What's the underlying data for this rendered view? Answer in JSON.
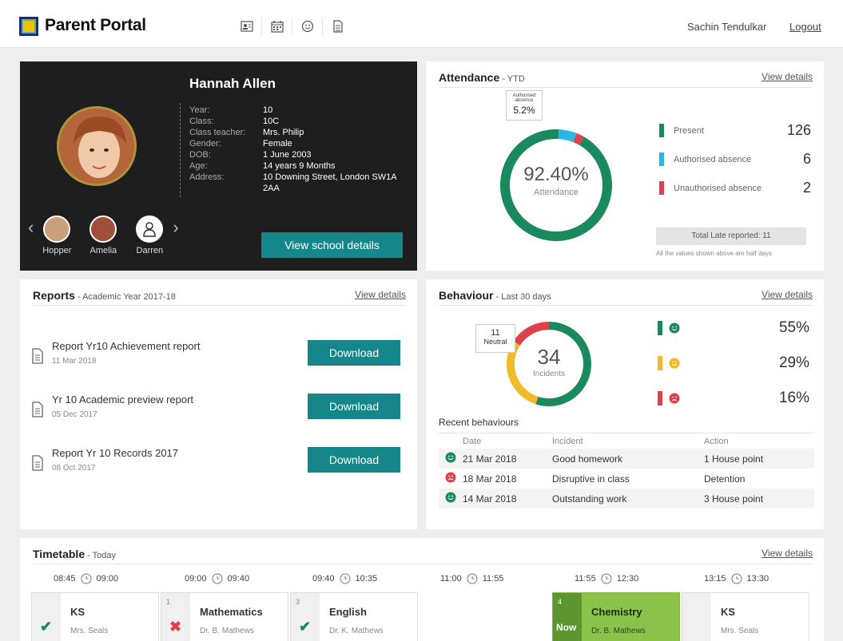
{
  "app": {
    "brand": "Parent Portal",
    "user": "Sachin Tendulkar",
    "logout": "Logout",
    "nav_icons": [
      "id-card-icon",
      "calendar-icon",
      "smiley-icon",
      "document-icon"
    ]
  },
  "student": {
    "name": "Hannah Allen",
    "fields": [
      {
        "label": "Year:",
        "value": "10"
      },
      {
        "label": "Class:",
        "value": "10C"
      },
      {
        "label": "Class teacher:",
        "value": "Mrs. Philip"
      },
      {
        "label": "Gender:",
        "value": "Female"
      },
      {
        "label": "DOB:",
        "value": "1 June 2003"
      },
      {
        "label": "Age:",
        "value": "14 years 9 Months"
      },
      {
        "label": "Address:",
        "value": "10 Downing Street, London SW1A 2AA"
      }
    ],
    "siblings": [
      "Hopper",
      "Amelia",
      "Darren"
    ],
    "view_button": "View school details"
  },
  "attendance": {
    "title": "Attendance",
    "subtitle": " - YTD",
    "view": "View details",
    "center_value": "92.40%",
    "center_label": "Attendance",
    "callout_label": "Authorised absence",
    "callout_value": "5.2%",
    "fractions": {
      "present": 0.924,
      "authorised": 0.052,
      "unauthorised": 0.024
    },
    "legend": [
      {
        "label": "Present",
        "value": "126",
        "color": "#1a8a5e"
      },
      {
        "label": "Authorised absence",
        "value": "6",
        "color": "#29b6e8"
      },
      {
        "label": "Unauthorised absence",
        "value": "2",
        "color": "#e0404a"
      }
    ],
    "late": "Total Late reported: 11",
    "note": "All the values shown above are half days"
  },
  "reports": {
    "title": "Reports",
    "subtitle": " - Academic Year 2017-18",
    "view": "View details",
    "items": [
      {
        "title": "Report Yr10 Achievement report",
        "date": "11 Mar 2018",
        "button": "Download"
      },
      {
        "title": "Yr 10 Academic preview report",
        "date": "05 Dec 2017",
        "button": "Download"
      },
      {
        "title": "Report Yr 10 Records 2017",
        "date": "08 Oct 2017",
        "button": "Download"
      }
    ]
  },
  "behaviour": {
    "title": "Behaviour",
    "subtitle": " - Last 30 days",
    "view": "View details",
    "center_value": "34",
    "center_label": "Incidents",
    "callout_value": "11",
    "callout_label": "Neutral",
    "fractions": {
      "positive": 0.55,
      "neutral": 0.29,
      "negative": 0.16
    },
    "legend": [
      {
        "value": "55%",
        "color": "#1a8a5e",
        "face": "happy-face-icon"
      },
      {
        "value": "29%",
        "color": "#f2b929",
        "face": "neutral-face-icon"
      },
      {
        "value": "16%",
        "color": "#e0404a",
        "face": "sad-face-icon"
      }
    ],
    "recent_title": "Recent behaviours",
    "columns": [
      "Date",
      "Incident",
      "Action"
    ],
    "rows": [
      {
        "face": "happy",
        "date": "21 Mar 2018",
        "incident": "Good homework",
        "action": "1 House point"
      },
      {
        "face": "sad",
        "date": "18 Mar 2018",
        "incident": "Disruptive in class",
        "action": "Detention"
      },
      {
        "face": "happy",
        "date": "14 Mar 2018",
        "incident": "Outstanding work",
        "action": "3 House point"
      }
    ]
  },
  "timetable": {
    "title": "Timetable",
    "subtitle": " - Today",
    "view": "View details",
    "times": [
      {
        "start": "08:45",
        "end": "09:00"
      },
      {
        "start": "09:00",
        "end": "09:40"
      },
      {
        "start": "09:40",
        "end": "10:35"
      },
      {
        "start": "11:00",
        "end": "11:55"
      },
      {
        "start": "11:55",
        "end": "12:30"
      },
      {
        "start": "13:15",
        "end": "13:30"
      }
    ],
    "slots": [
      {
        "no": "",
        "mark": "✔",
        "subject": "KS",
        "teacher": "Mrs. Seals",
        "state": "done"
      },
      {
        "no": "1",
        "mark": "✖",
        "subject": "Mathematics",
        "teacher": "Dr. B. Mathews",
        "state": "missed"
      },
      {
        "no": "3",
        "mark": "✔",
        "subject": "English",
        "teacher": "Dr. K. Mathews",
        "state": "done"
      },
      {
        "no": "4",
        "mark": "Now",
        "subject": "Chemistry",
        "teacher": "Dr. B. Mathews",
        "state": "now"
      },
      {
        "no": "",
        "mark": "",
        "subject": "KS",
        "teacher": "Mrs. Seals",
        "state": "upcoming"
      }
    ]
  }
}
